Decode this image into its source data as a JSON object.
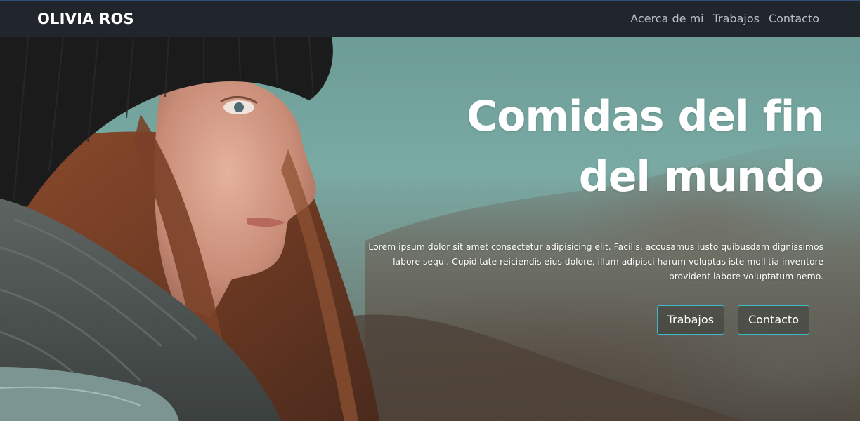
{
  "navbar": {
    "brand": "OLIVIA ROS",
    "links": [
      "Acerca de mi",
      "Trabajos",
      "Contacto"
    ]
  },
  "hero": {
    "title_line1": "Comidas del fin",
    "title_line2": "del mundo",
    "description": "Lorem ipsum dolor sit amet consectetur adipisicing elit. Facilis, accusamus iusto quibusdam dignissimos labore sequi. Cupiditate reiciendis eius dolore, illum adipisci harum voluptas iste mollitia inventore provident labore voluptatum nemo.",
    "buttons": [
      "Trabajos",
      "Contacto"
    ]
  },
  "colors": {
    "navbar_bg": "#21262d",
    "button_border": "#3fb8c9",
    "title_text": "#ffffff"
  }
}
